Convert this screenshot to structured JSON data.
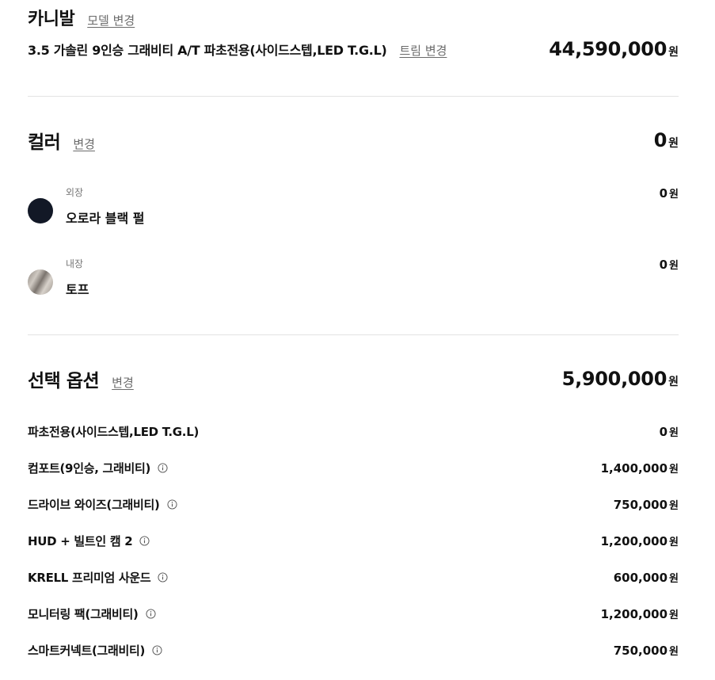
{
  "model": {
    "name": "카니발",
    "change_label": "모델 변경",
    "trim_name": "3.5 가솔린 9인승 그래비티 A/T 파초전용(사이드스텝,LED T.G.L)",
    "trim_change_label": "트림 변경",
    "price": "44,590,000",
    "unit": "원"
  },
  "color": {
    "title": "컬러",
    "change_label": "변경",
    "total": "0",
    "unit": "원",
    "exterior": {
      "category": "외장",
      "name": "오로라 블랙 펄",
      "price": "0",
      "unit": "원",
      "swatch_color": "#121826"
    },
    "interior": {
      "category": "내장",
      "name": "토프",
      "price": "0",
      "unit": "원",
      "swatch_color": "#a8a19a"
    }
  },
  "options": {
    "title": "선택 옵션",
    "change_label": "변경",
    "total": "5,900,000",
    "unit": "원",
    "items": [
      {
        "name": "파초전용(사이드스텝,LED T.G.L)",
        "price": "0",
        "unit": "원",
        "has_info": false
      },
      {
        "name": "컴포트(9인승, 그래비티)",
        "price": "1,400,000",
        "unit": "원",
        "has_info": true
      },
      {
        "name": "드라이브 와이즈(그래비티)",
        "price": "750,000",
        "unit": "원",
        "has_info": true
      },
      {
        "name": "HUD + 빌트인 캠 2",
        "price": "1,200,000",
        "unit": "원",
        "has_info": true
      },
      {
        "name": "KRELL 프리미엄 사운드",
        "price": "600,000",
        "unit": "원",
        "has_info": true
      },
      {
        "name": "모니터링 팩(그래비티)",
        "price": "1,200,000",
        "unit": "원",
        "has_info": true
      },
      {
        "name": "스마트커넥트(그래비티)",
        "price": "750,000",
        "unit": "원",
        "has_info": true
      }
    ],
    "info_icon": "info-circle-icon"
  }
}
